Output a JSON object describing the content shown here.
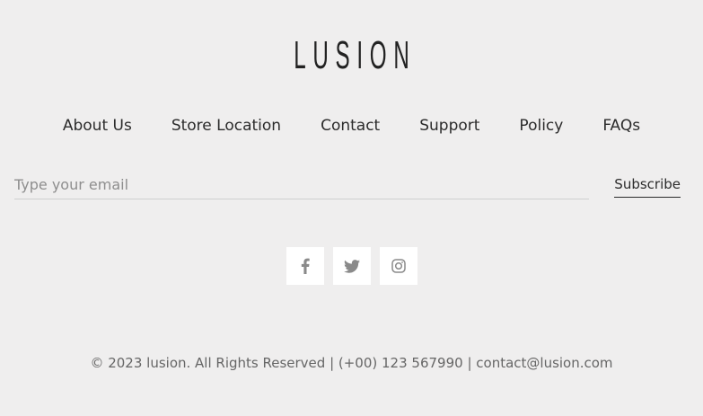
{
  "brand": {
    "logo_text": "LUSION"
  },
  "nav": {
    "items": [
      {
        "label": "About Us"
      },
      {
        "label": "Store Location"
      },
      {
        "label": "Contact"
      },
      {
        "label": "Support"
      },
      {
        "label": "Policy"
      },
      {
        "label": "FAQs"
      }
    ]
  },
  "newsletter": {
    "email_placeholder": "Type your email",
    "email_value": "",
    "subscribe_label": "Subscribe"
  },
  "social": {
    "icons": [
      {
        "icon": "facebook-icon"
      },
      {
        "icon": "twitter-icon"
      },
      {
        "icon": "instagram-icon"
      }
    ],
    "icon_color": "#8a8a8a"
  },
  "footer": {
    "copyright": "© 2023 lusion. All Rights Reserved | (+00) 123 567990 | contact@lusion.com"
  },
  "colors": {
    "background": "#efeeee",
    "text": "#2b2b2b",
    "muted": "#666666",
    "social_bg": "#ffffff"
  }
}
